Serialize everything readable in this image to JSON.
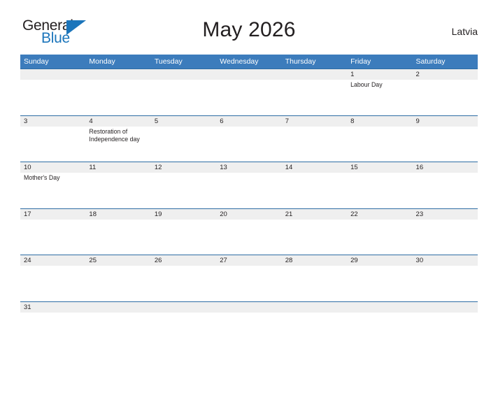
{
  "brand": {
    "name_part1": "General",
    "name_part2": "Blue",
    "accent_color": "#1b75bb"
  },
  "header": {
    "title": "May 2026",
    "country": "Latvia"
  },
  "calendar": {
    "header_color": "#3c7cbc",
    "row_border_color": "#2e6da4",
    "daynum_strip_color": "#efefef",
    "weekdays": [
      "Sunday",
      "Monday",
      "Tuesday",
      "Wednesday",
      "Thursday",
      "Friday",
      "Saturday"
    ],
    "weeks": [
      {
        "days": [
          {
            "date": "",
            "event": ""
          },
          {
            "date": "",
            "event": ""
          },
          {
            "date": "",
            "event": ""
          },
          {
            "date": "",
            "event": ""
          },
          {
            "date": "",
            "event": ""
          },
          {
            "date": "1",
            "event": "Labour Day"
          },
          {
            "date": "2",
            "event": ""
          }
        ]
      },
      {
        "days": [
          {
            "date": "3",
            "event": ""
          },
          {
            "date": "4",
            "event": "Restoration of Independence day"
          },
          {
            "date": "5",
            "event": ""
          },
          {
            "date": "6",
            "event": ""
          },
          {
            "date": "7",
            "event": ""
          },
          {
            "date": "8",
            "event": ""
          },
          {
            "date": "9",
            "event": ""
          }
        ]
      },
      {
        "days": [
          {
            "date": "10",
            "event": "Mother's Day"
          },
          {
            "date": "11",
            "event": ""
          },
          {
            "date": "12",
            "event": ""
          },
          {
            "date": "13",
            "event": ""
          },
          {
            "date": "14",
            "event": ""
          },
          {
            "date": "15",
            "event": ""
          },
          {
            "date": "16",
            "event": ""
          }
        ]
      },
      {
        "days": [
          {
            "date": "17",
            "event": ""
          },
          {
            "date": "18",
            "event": ""
          },
          {
            "date": "19",
            "event": ""
          },
          {
            "date": "20",
            "event": ""
          },
          {
            "date": "21",
            "event": ""
          },
          {
            "date": "22",
            "event": ""
          },
          {
            "date": "23",
            "event": ""
          }
        ]
      },
      {
        "days": [
          {
            "date": "24",
            "event": ""
          },
          {
            "date": "25",
            "event": ""
          },
          {
            "date": "26",
            "event": ""
          },
          {
            "date": "27",
            "event": ""
          },
          {
            "date": "28",
            "event": ""
          },
          {
            "date": "29",
            "event": ""
          },
          {
            "date": "30",
            "event": ""
          }
        ]
      },
      {
        "days": [
          {
            "date": "31",
            "event": ""
          },
          {
            "date": "",
            "event": ""
          },
          {
            "date": "",
            "event": ""
          },
          {
            "date": "",
            "event": ""
          },
          {
            "date": "",
            "event": ""
          },
          {
            "date": "",
            "event": ""
          },
          {
            "date": "",
            "event": ""
          }
        ]
      }
    ]
  }
}
